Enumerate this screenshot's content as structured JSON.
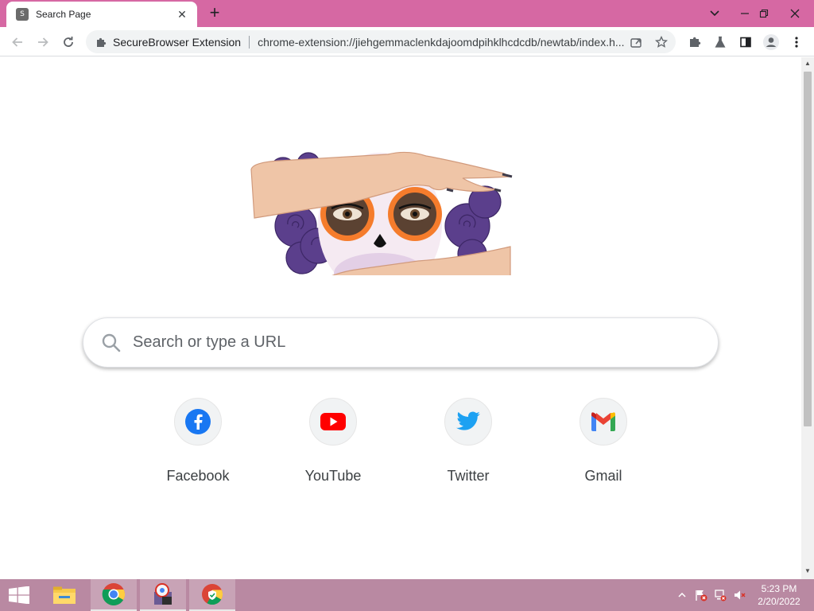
{
  "browser": {
    "tab_title": "Search Page",
    "tab_favicon_letter": "S",
    "omnibox_extension_label": "SecureBrowser Extension",
    "omnibox_url": "chrome-extension://jiehgemmaclenkdajoomdpihklhcdcdb/newtab/index.h..."
  },
  "page": {
    "search_placeholder": "Search or type a URL",
    "shortcuts": [
      {
        "label": "Facebook",
        "icon": "facebook-icon",
        "color": "#1877f2"
      },
      {
        "label": "YouTube",
        "icon": "youtube-icon",
        "color": "#ff0000"
      },
      {
        "label": "Twitter",
        "icon": "twitter-icon",
        "color": "#1da1f2"
      },
      {
        "label": "Gmail",
        "icon": "gmail-icon",
        "color": "#ea4335"
      }
    ]
  },
  "taskbar": {
    "time": "5:23 PM",
    "date": "2/20/2022",
    "apps": [
      "file-explorer-icon",
      "chrome-icon",
      "installer-icon",
      "securebrowser-icon"
    ]
  },
  "colors": {
    "titlebar": "#d668a3",
    "taskbar": "#b989a2",
    "scrollbar_thumb": "#c1c1c1"
  }
}
